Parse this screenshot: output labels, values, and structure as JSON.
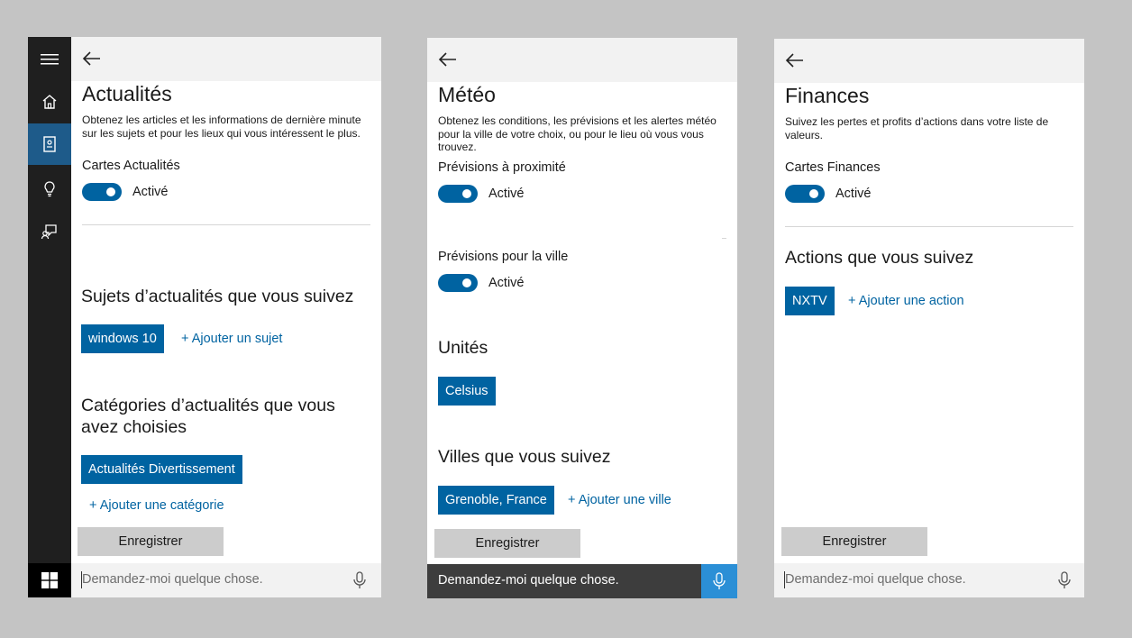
{
  "search": {
    "placeholder": "Demandez-moi quelque chose."
  },
  "sidebar": {
    "items": [
      {
        "icon": "hamburger-menu-icon"
      },
      {
        "icon": "home-icon"
      },
      {
        "icon": "notebook-icon",
        "active": true
      },
      {
        "icon": "lightbulb-icon"
      },
      {
        "icon": "feedback-icon"
      }
    ],
    "start_icon": "windows-start-icon"
  },
  "news": {
    "title": "Actualités",
    "description": "Obtenez les articles et les informations de dernière minute sur les sujets et pour les lieux qui vous intéressent le plus.",
    "cards_label": "Cartes Actualités",
    "cards_state": "Activé",
    "topics_heading": "Sujets d’actualités que vous suivez",
    "topics": [
      "windows 10"
    ],
    "add_topic": "+ Ajouter un sujet",
    "categories_heading": "Catégories d’actualités que vous avez choisies",
    "categories": [
      "Actualités Divertissement"
    ],
    "add_category": "+ Ajouter une catégorie",
    "save": "Enregistrer"
  },
  "weather": {
    "title": "Météo",
    "description": "Obtenez les conditions, les prévisions et les alertes météo pour la ville de votre choix, ou pour le lieu où vous vous trouvez.",
    "nearby_label": "Prévisions à proximité",
    "nearby_state": "Activé",
    "city_label": "Prévisions pour la ville",
    "city_state": "Activé",
    "units_heading": "Unités",
    "units_value": "Celsius",
    "cities_heading": "Villes que vous suivez",
    "cities": [
      "Grenoble, France"
    ],
    "add_city": "+ Ajouter une ville",
    "save": "Enregistrer"
  },
  "finance": {
    "title": "Finances",
    "description": "Suivez les pertes et profits d’actions dans votre liste de valeurs.",
    "cards_label": "Cartes Finances",
    "cards_state": "Activé",
    "stocks_heading": "Actions que vous suivez",
    "stocks": [
      "NXTV"
    ],
    "add_stock": "+ Ajouter une action",
    "save": "Enregistrer"
  },
  "colors": {
    "accent": "#0063a1",
    "sidebar_bg": "#1f1f1f",
    "sidebar_active": "#1e5b8a",
    "dark_searchbar": "#3d3d3d",
    "mic_active": "#2b8fd6",
    "page_bg": "#c4c4c4"
  }
}
